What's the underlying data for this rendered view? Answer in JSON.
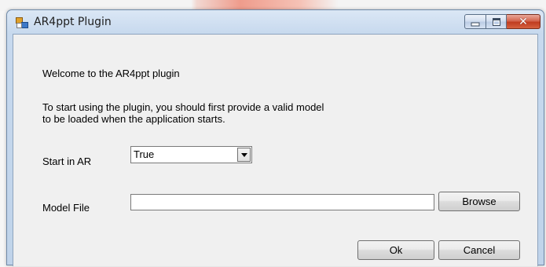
{
  "window": {
    "title": "AR4ppt Plugin",
    "icon": "form-window-icon"
  },
  "titlebar_buttons": {
    "minimize": "minimize-icon",
    "maximize": "maximize-icon",
    "close": "close-icon",
    "close_glyph": "✕"
  },
  "form": {
    "welcome_text": "Welcome to the AR4ppt plugin",
    "instruction_line1": "To start using the plugin, you should first provide a valid model",
    "instruction_line2": "to be loaded when the application starts.",
    "start_in_ar_label": "Start in AR",
    "start_in_ar_value": "True",
    "model_file_label": "Model File",
    "model_file_value": "",
    "browse_label": "Browse",
    "ok_label": "Ok",
    "cancel_label": "Cancel"
  },
  "colors": {
    "close_button": "#c8432a",
    "title_bar": "#c7d9ee",
    "client_background": "#f0f0f0"
  }
}
